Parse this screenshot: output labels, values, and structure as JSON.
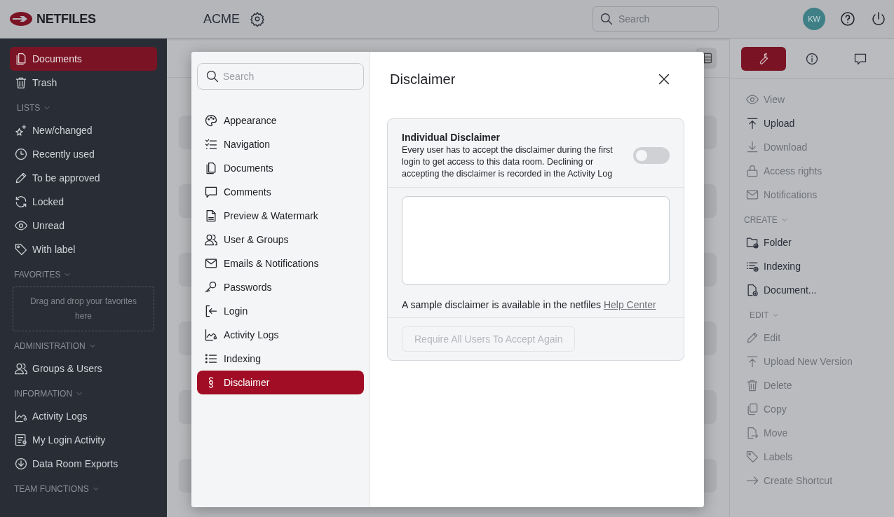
{
  "topbar": {
    "brand": "NETFILES",
    "room": "ACME",
    "search": {
      "placeholder": "Search"
    },
    "avatar": "KW"
  },
  "sidebar": {
    "items": [
      {
        "label": "Documents",
        "selected": true
      },
      {
        "label": "Trash",
        "selected": false
      }
    ],
    "sections": [
      {
        "title": "LISTS",
        "items": [
          {
            "label": "New/changed",
            "selected": false
          },
          {
            "label": "Recently used",
            "selected": false
          },
          {
            "label": "To be approved",
            "selected": false
          },
          {
            "label": "Locked",
            "selected": false
          },
          {
            "label": "Unread",
            "selected": false
          },
          {
            "label": "With label",
            "selected": false
          }
        ]
      },
      {
        "title": "FAVORITES",
        "dropzone": "Drag and drop your favorites here"
      },
      {
        "title": "ADMINISTRATION",
        "items": [
          {
            "label": "Groups & Users",
            "selected": false
          }
        ]
      },
      {
        "title": "INFORMATION",
        "items": [
          {
            "label": "Activity Logs",
            "selected": false
          },
          {
            "label": "My Login Activity",
            "selected": false
          },
          {
            "label": "Data Room Exports",
            "selected": false
          }
        ]
      },
      {
        "title": "TEAM FUNCTIONS"
      }
    ]
  },
  "right_panel": {
    "tabs": [
      {
        "selected": true
      },
      {
        "selected": false
      },
      {
        "selected": false
      }
    ],
    "groups": [
      {
        "items": [
          {
            "label": "View",
            "disabled": true
          },
          {
            "label": "Upload",
            "disabled": false
          },
          {
            "label": "Download",
            "disabled": true
          },
          {
            "label": "Access rights",
            "disabled": true
          },
          {
            "label": "Notifications",
            "disabled": true
          }
        ]
      },
      {
        "title": "CREATE",
        "items": [
          {
            "label": "Folder",
            "disabled": false
          },
          {
            "label": "Indexing",
            "disabled": false
          },
          {
            "label": "Document...",
            "disabled": false
          }
        ]
      },
      {
        "title": "EDIT",
        "items": [
          {
            "label": "Edit",
            "disabled": true
          },
          {
            "label": "Upload New Version",
            "disabled": true
          },
          {
            "label": "Delete",
            "disabled": true
          },
          {
            "label": "Copy",
            "disabled": true
          },
          {
            "label": "Move",
            "disabled": true
          },
          {
            "label": "Labels",
            "disabled": true
          },
          {
            "label": "Create Shortcut",
            "disabled": true
          }
        ]
      }
    ]
  },
  "dialog": {
    "search": {
      "placeholder": "Search"
    },
    "nav": [
      {
        "label": "Appearance",
        "selected": false
      },
      {
        "label": "Navigation",
        "selected": false
      },
      {
        "label": "Documents",
        "selected": false
      },
      {
        "label": "Comments",
        "selected": false
      },
      {
        "label": "Preview & Watermark",
        "selected": false
      },
      {
        "label": "User & Groups",
        "selected": false
      },
      {
        "label": "Emails & Notifications",
        "selected": false
      },
      {
        "label": "Passwords",
        "selected": false
      },
      {
        "label": "Login",
        "selected": false
      },
      {
        "label": "Activity Logs",
        "selected": false
      },
      {
        "label": "Indexing",
        "selected": false
      },
      {
        "label": "Disclaimer",
        "selected": true
      }
    ],
    "title": "Disclaimer",
    "setting": {
      "title": "Individual Disclaimer",
      "description": "Every user has to accept the disclaimer during the first login to get access to this data room. Declining or accepting the disclaimer is recorded in the Activity Log",
      "on": false
    },
    "help_text": "A sample disclaimer is available in the netfiles ",
    "help_link": "Help Center",
    "button": {
      "label": "Require All Users To Accept Again",
      "disabled": true
    }
  }
}
